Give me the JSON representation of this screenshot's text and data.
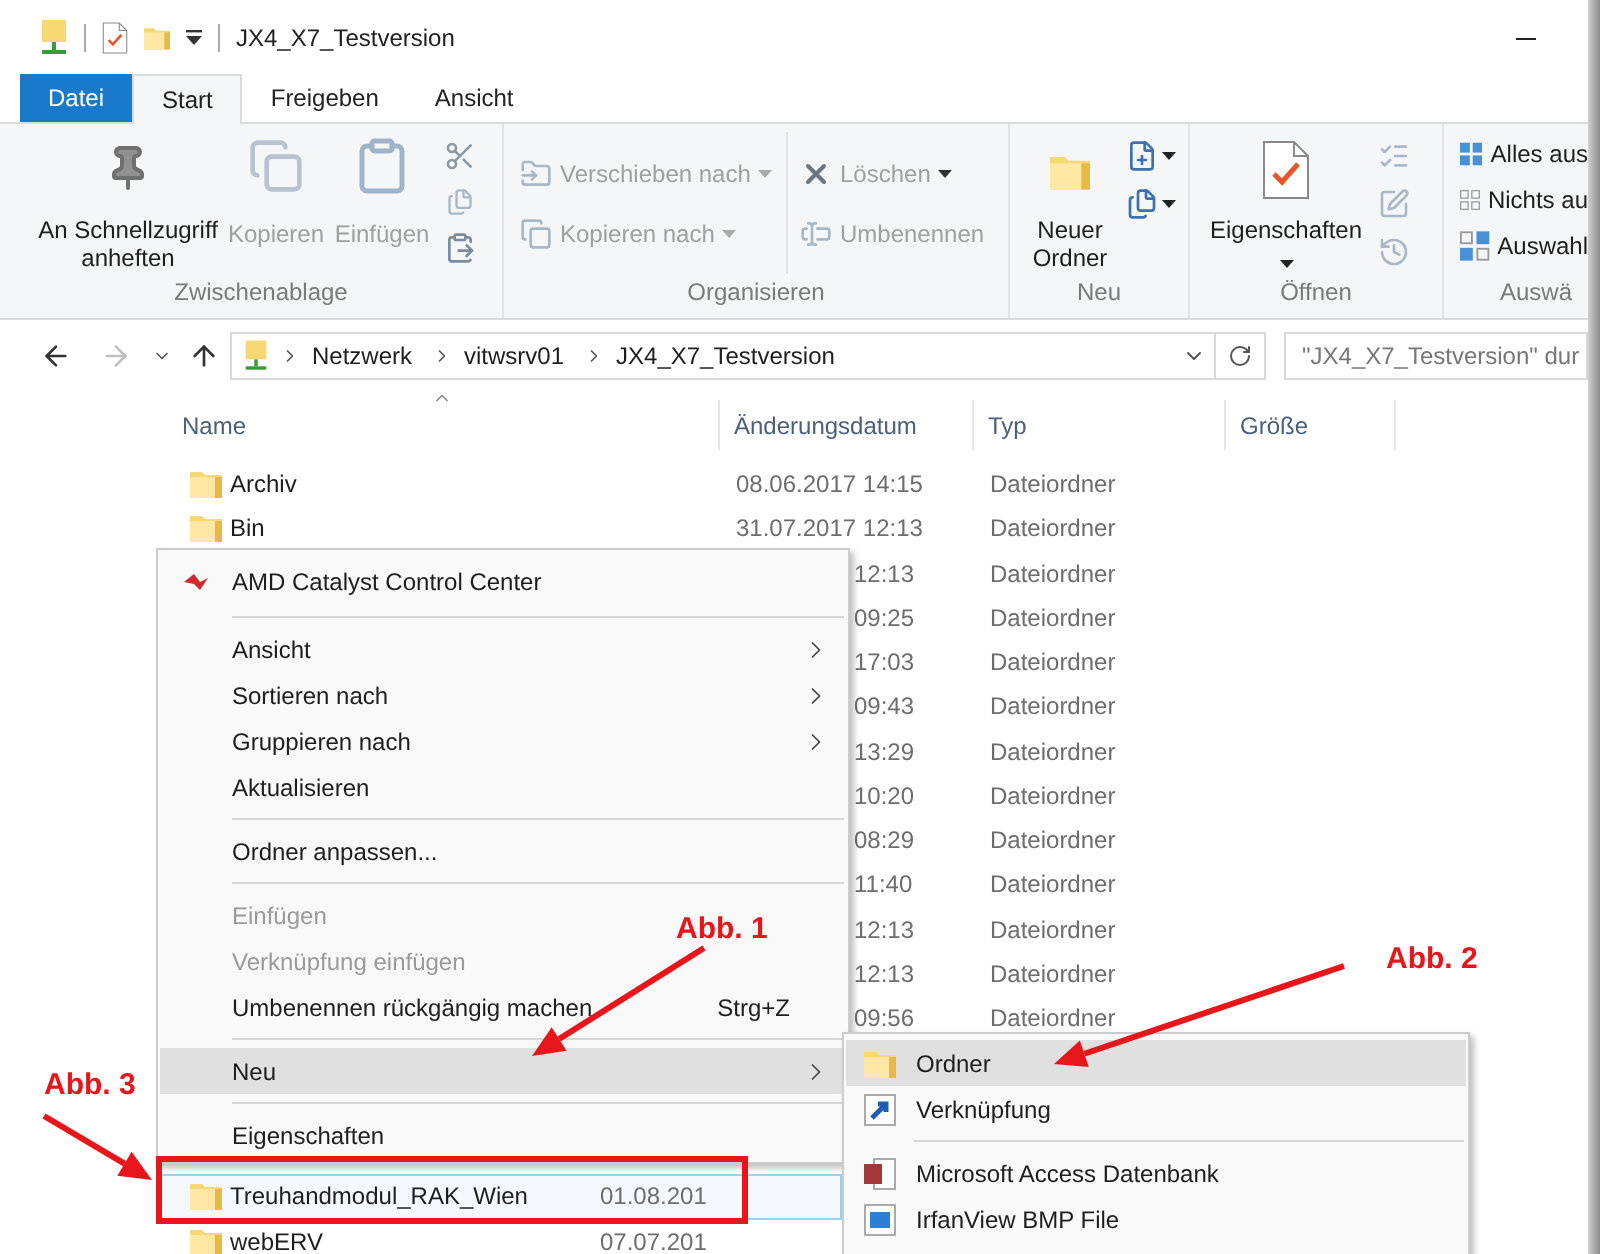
{
  "window": {
    "title": "JX4_X7_Testversion"
  },
  "ribbon_tabs": [
    {
      "label": "Datei",
      "kind": "file",
      "selected": false
    },
    {
      "label": "Start",
      "kind": "tab",
      "selected": true
    },
    {
      "label": "Freigeben",
      "kind": "tab",
      "selected": false
    },
    {
      "label": "Ansicht",
      "kind": "tab",
      "selected": false
    }
  ],
  "ribbon": {
    "clipboard": {
      "label": "Zwischenablage",
      "pin": {
        "label": "An Schnellzugriff anheften",
        "disabled": false
      },
      "copy": {
        "label": "Kopieren",
        "disabled": true
      },
      "paste": {
        "label": "Einfügen",
        "disabled": true
      }
    },
    "organize": {
      "label": "Organisieren",
      "move_to": {
        "label": "Verschieben nach",
        "disabled": true
      },
      "copy_to": {
        "label": "Kopieren nach",
        "disabled": true
      },
      "delete": {
        "label": "Löschen",
        "disabled": true
      },
      "rename": {
        "label": "Umbenennen",
        "disabled": true
      }
    },
    "new": {
      "label": "Neu",
      "new_folder": {
        "label": "Neuer Ordner",
        "disabled": false
      }
    },
    "open": {
      "label": "Öffnen",
      "properties": {
        "label": "Eigenschaften",
        "disabled": false
      }
    },
    "select": {
      "label": "Auswä",
      "select_all": {
        "label": "Alles aus"
      },
      "select_none": {
        "label": "Nichts au"
      },
      "invert": {
        "label": "Auswahl"
      }
    }
  },
  "navigation": {
    "back_disabled": false,
    "forward_disabled": true
  },
  "address": {
    "segments": [
      "Netzwerk",
      "vitwsrv01",
      "JX4_X7_Testversion"
    ],
    "search_placeholder": "\"JX4_X7_Testversion\" dur"
  },
  "columns": [
    "Name",
    "Änderungsdatum",
    "Typ",
    "Größe"
  ],
  "files": [
    {
      "name": "Archiv",
      "date": "08.06.2017 14:15",
      "type": "Dateiordner",
      "selected": false
    },
    {
      "name": "Bin",
      "date": "31.07.2017 12:13",
      "type": "Dateiordner",
      "selected": false
    },
    {
      "date": "12:13",
      "type": "Dateiordner",
      "selected": false
    },
    {
      "date": "09:25",
      "type": "Dateiordner",
      "selected": false
    },
    {
      "date": "17:03",
      "type": "Dateiordner",
      "selected": false
    },
    {
      "date": "09:43",
      "type": "Dateiordner",
      "selected": false
    },
    {
      "date": "13:29",
      "type": "Dateiordner",
      "selected": false
    },
    {
      "date": "10:20",
      "type": "Dateiordner",
      "selected": false
    },
    {
      "date": "08:29",
      "type": "Dateiordner",
      "selected": false
    },
    {
      "date": "11:40",
      "type": "Dateiordner",
      "selected": false
    },
    {
      "date": "12:13",
      "type": "Dateiordner",
      "selected": false
    },
    {
      "date": "12:13",
      "type": "Dateiordner",
      "selected": false
    },
    {
      "date": "09:56",
      "type": "Dateiordner",
      "selected": false
    }
  ],
  "files_continued": [
    {
      "name": "Treuhandmodul_RAK_Wien",
      "date": "01.08.201",
      "selected": true
    },
    {
      "name": "webERV",
      "date": "07.07.201",
      "selected": false
    }
  ],
  "context_menu": {
    "items": [
      {
        "kind": "app",
        "label": "AMD Catalyst Control Center",
        "selected": false,
        "disabled": false,
        "submenu": false
      },
      {
        "kind": "separator"
      },
      {
        "kind": "item",
        "label": "Ansicht",
        "selected": false,
        "disabled": false,
        "submenu": true
      },
      {
        "kind": "item",
        "label": "Sortieren nach",
        "selected": false,
        "disabled": false,
        "submenu": true
      },
      {
        "kind": "item",
        "label": "Gruppieren nach",
        "selected": false,
        "disabled": false,
        "submenu": true
      },
      {
        "kind": "item",
        "label": "Aktualisieren",
        "selected": false,
        "disabled": false,
        "submenu": false
      },
      {
        "kind": "separator"
      },
      {
        "kind": "item",
        "label": "Ordner anpassen...",
        "selected": false,
        "disabled": false,
        "submenu": false
      },
      {
        "kind": "separator"
      },
      {
        "kind": "item",
        "label": "Einfügen",
        "selected": false,
        "disabled": true,
        "submenu": false
      },
      {
        "kind": "item",
        "label": "Verknüpfung einfügen",
        "selected": false,
        "disabled": true,
        "submenu": false
      },
      {
        "kind": "item",
        "label": "Umbenennen rückgängig machen",
        "shortcut": "Strg+Z",
        "selected": false,
        "disabled": false,
        "submenu": false
      },
      {
        "kind": "separator"
      },
      {
        "kind": "item",
        "label": "Neu",
        "selected": true,
        "disabled": false,
        "submenu": true
      },
      {
        "kind": "separator"
      },
      {
        "kind": "item",
        "label": "Eigenschaften",
        "selected": false,
        "disabled": false,
        "submenu": false
      }
    ]
  },
  "new_submenu": {
    "items": [
      {
        "kind": "folder",
        "label": "Ordner",
        "selected": true
      },
      {
        "kind": "link",
        "label": "Verknüpfung",
        "selected": false
      },
      {
        "kind": "separator"
      },
      {
        "kind": "access",
        "label": "Microsoft Access Datenbank",
        "selected": false
      },
      {
        "kind": "bitmap",
        "label": "IrfanView BMP File",
        "selected": false
      }
    ]
  },
  "annotations": [
    {
      "label": "Abb. 1"
    },
    {
      "label": "Abb. 2"
    },
    {
      "label": "Abb. 3"
    }
  ]
}
